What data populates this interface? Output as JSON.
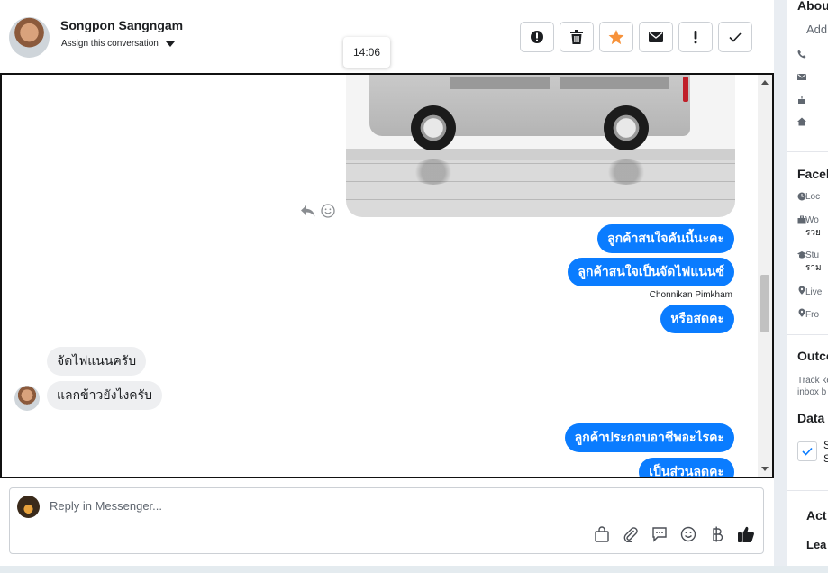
{
  "header": {
    "contact_name": "Songpon Sangngam",
    "assign_label": "Assign this conversation",
    "actions": [
      {
        "name": "mark-spam-button",
        "icon": "alert-circle-icon"
      },
      {
        "name": "delete-button",
        "icon": "trash-icon"
      },
      {
        "name": "star-button",
        "icon": "star-icon"
      },
      {
        "name": "mark-unread-button",
        "icon": "envelope-icon"
      },
      {
        "name": "follow-up-button",
        "icon": "exclamation-icon"
      },
      {
        "name": "mark-done-button",
        "icon": "checkmark-icon"
      }
    ]
  },
  "tooltip": {
    "time": "14:06"
  },
  "messages": {
    "out_1": "ลูกค้าสนใจคันนี้นะคะ",
    "out_2": "ลูกค้าสนใจเป็นจัดไฟแนนซ์",
    "sender_name": "Chonnikan Pimkham",
    "out_3": "หรือสดคะ",
    "in_1": "จัดไฟแนนครับ",
    "in_2": "แลกข้าวยังไงครับ",
    "out_4": "ลูกค้าประกอบอาชีพอะไรคะ",
    "out_5": "เป็นส่วนลดคะ"
  },
  "composer": {
    "placeholder": "Reply in Messenger...",
    "tools": [
      "shop-bag-icon",
      "paperclip-icon",
      "saved-reply-icon",
      "emoji-icon",
      "baht-icon",
      "thumbs-up-icon"
    ]
  },
  "right_panel": {
    "about_heading": "About",
    "add_text": "Add",
    "facebook_heading": "Faceb",
    "fb_items": [
      "Loc",
      "Wo",
      "รวย",
      "Stu",
      "ราม",
      "Live",
      "Fro"
    ],
    "outcome_heading": "Outco",
    "outcome_text_1": "Track ke",
    "outcome_text_2": "inbox b",
    "data_heading": "Data",
    "data_check_1": "S",
    "data_check_2": "S",
    "activity_heading": "Act",
    "lead_heading": "Lea"
  },
  "colors": {
    "messenger_blue": "#0a7cff",
    "star_orange": "#f7923a",
    "incoming_bubble": "#eeeff1"
  }
}
